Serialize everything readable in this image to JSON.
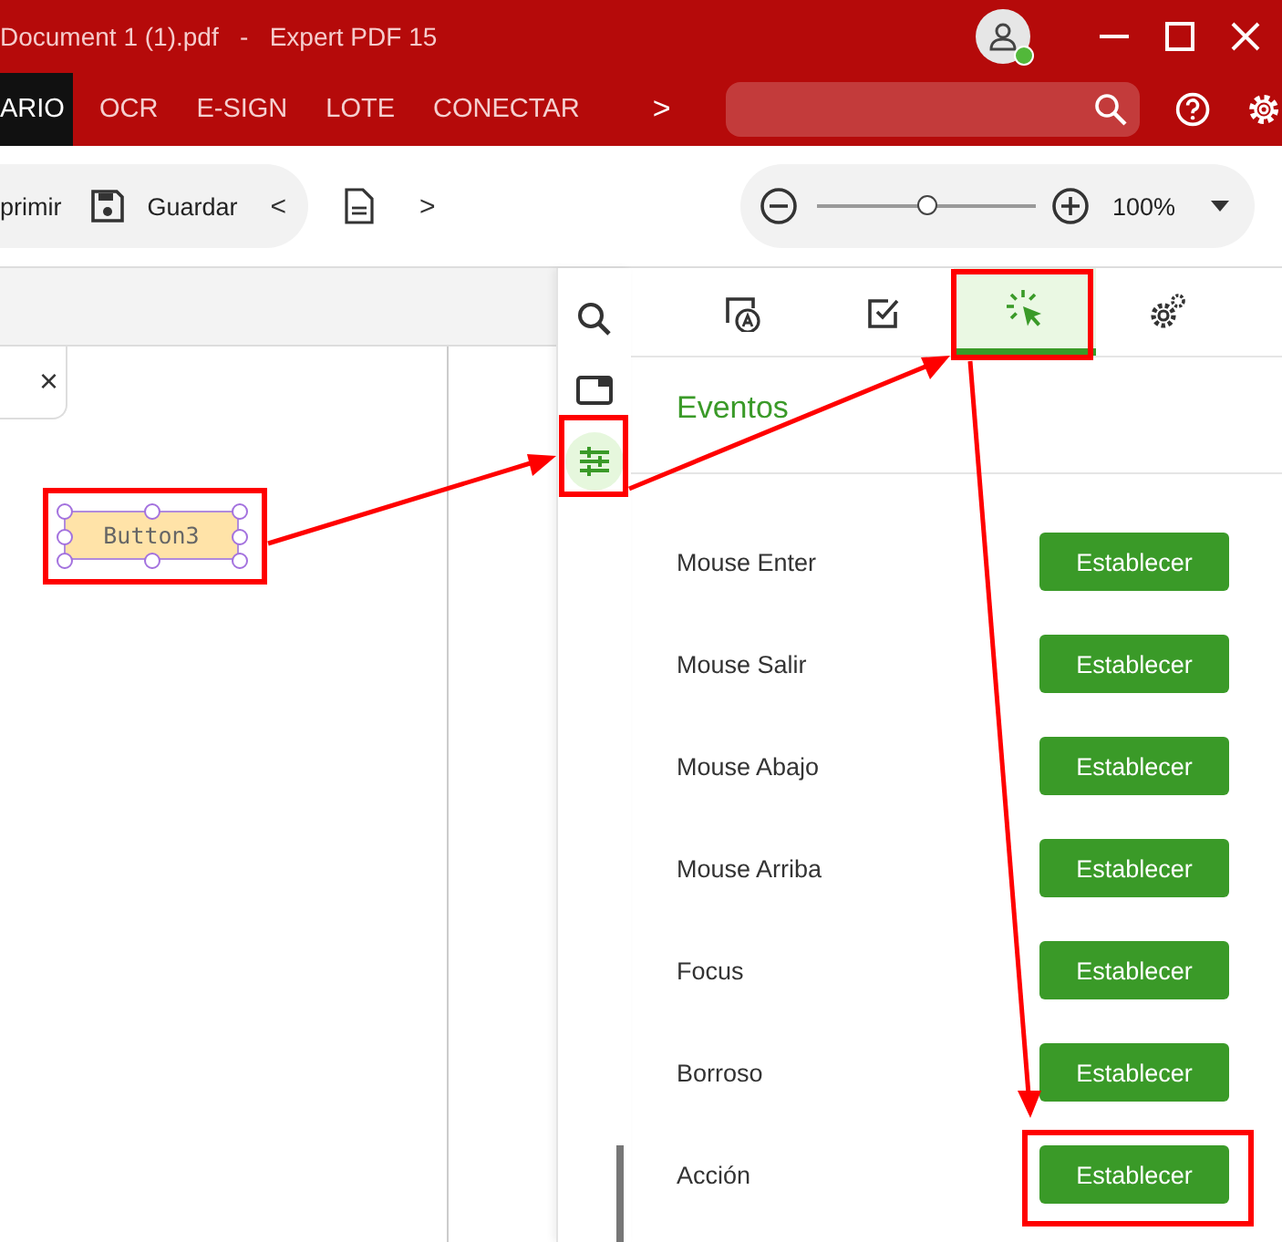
{
  "window": {
    "title": "Document 1 (1).pdf   -   Expert PDF 15",
    "user_online": true
  },
  "ribbon_tabs": [
    {
      "label": "ARIO",
      "selected": true
    },
    {
      "label": "OCR",
      "selected": false
    },
    {
      "label": "E-SIGN",
      "selected": false
    },
    {
      "label": "LOTE",
      "selected": false
    },
    {
      "label": "CONECTAR",
      "selected": false
    }
  ],
  "ribbon_more": ">",
  "toolbar": {
    "items": [
      {
        "kind": "text",
        "label": "primir"
      },
      {
        "kind": "save",
        "label": "Guardar"
      }
    ],
    "prev": "<",
    "next": ">"
  },
  "zoom": {
    "level": 0.51,
    "reading": "100%"
  },
  "document": {
    "form_field": "Button3",
    "tab_close": "×"
  },
  "side_tools": [
    {
      "kind": "search",
      "selected": false
    },
    {
      "kind": "panel",
      "selected": false
    },
    {
      "kind": "sliders",
      "selected": true
    }
  ],
  "panel_tabs": [
    {
      "kind": "text-field",
      "selected": false
    },
    {
      "kind": "checkbox",
      "selected": false
    },
    {
      "kind": "click",
      "selected": true
    },
    {
      "kind": "gears",
      "selected": false
    }
  ],
  "panel_heading": "Eventos",
  "events": [
    {
      "label": "Mouse Enter",
      "button": "Establecer"
    },
    {
      "label": "Mouse Salir",
      "button": "Establecer"
    },
    {
      "label": "Mouse Abajo",
      "button": "Establecer"
    },
    {
      "label": "Mouse Arriba",
      "button": "Establecer"
    },
    {
      "label": "Focus",
      "button": "Establecer"
    },
    {
      "label": "Borroso",
      "button": "Establecer"
    },
    {
      "label": "Acción",
      "button": "Establecer"
    }
  ]
}
